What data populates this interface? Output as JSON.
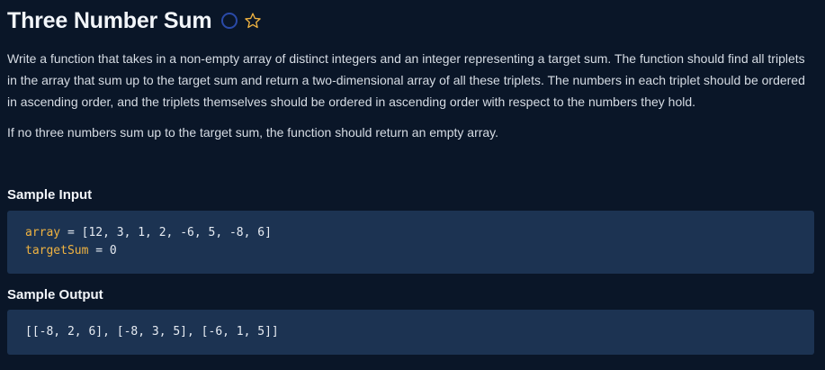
{
  "problem": {
    "title": "Three Number Sum",
    "description_1": "Write a function that takes in a non-empty array of distinct integers and an integer representing a target sum. The function should find all triplets in the array that sum up to the target sum and return a two-dimensional array of all these triplets. The numbers in each triplet should be ordered in ascending order, and the triplets themselves should be ordered in ascending order with respect to the numbers they hold.",
    "description_2": "If no three numbers sum up to the target sum, the function should return an empty array."
  },
  "sample_input": {
    "heading": "Sample Input",
    "line1_name": "array",
    "line1_rest": " = [12, 3, 1, 2, -6, 5, -8, 6]",
    "line2_name": "targetSum",
    "line2_rest": " = 0"
  },
  "sample_output": {
    "heading": "Sample Output",
    "value": "[[-8, 2, 6], [-8, 3, 5], [-6, 1, 5]]"
  },
  "colors": {
    "background": "#0a1628",
    "code_background": "#1c3352",
    "identifier": "#f0b341",
    "star": "#f0b341",
    "status_ring": "#2a4aa8"
  },
  "icons": {
    "status": "circle-outline-icon",
    "favorite": "star-outline-icon"
  }
}
